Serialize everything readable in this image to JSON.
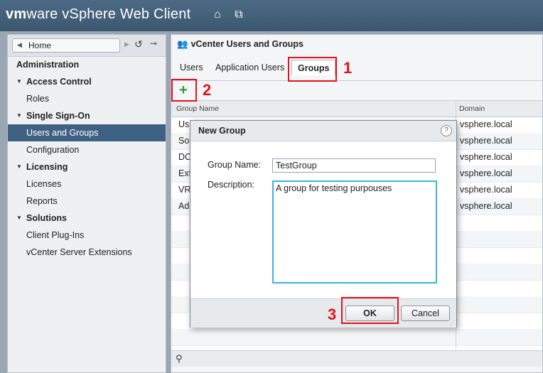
{
  "app": {
    "brand_bold": "vm",
    "brand_rest": "ware",
    "product": " vSphere Web Client"
  },
  "topbar": {
    "home_icon": "home-icon",
    "window_icon": "windows-icon"
  },
  "nav": {
    "home_label": "Home",
    "items": [
      {
        "label": "Administration",
        "kind": "section"
      },
      {
        "label": "Access Control",
        "kind": "group"
      },
      {
        "label": "Roles",
        "kind": "child"
      },
      {
        "label": "Single Sign-On",
        "kind": "group"
      },
      {
        "label": "Users and Groups",
        "kind": "child",
        "selected": true
      },
      {
        "label": "Configuration",
        "kind": "child"
      },
      {
        "label": "Licensing",
        "kind": "group"
      },
      {
        "label": "Licenses",
        "kind": "child"
      },
      {
        "label": "Reports",
        "kind": "child"
      },
      {
        "label": "Solutions",
        "kind": "group"
      },
      {
        "label": "Client Plug-Ins",
        "kind": "child"
      },
      {
        "label": "vCenter Server Extensions",
        "kind": "child"
      }
    ]
  },
  "main": {
    "title": "vCenter Users and Groups",
    "tabs": [
      {
        "label": "Users"
      },
      {
        "label": "Application Users"
      },
      {
        "label": "Groups",
        "active": true
      }
    ],
    "columns": [
      "Group Name",
      "Domain"
    ],
    "rows": [
      [
        "Us",
        "vsphere.local"
      ],
      [
        "So",
        "vsphere.local"
      ],
      [
        "DC",
        "vsphere.local"
      ],
      [
        "Ext",
        "vsphere.local"
      ],
      [
        "VR",
        "vsphere.local"
      ],
      [
        "Adı",
        "vsphere.local"
      ]
    ]
  },
  "dialog": {
    "title": "New Group",
    "help": "?",
    "group_name_label": "Group Name:",
    "group_name_value": "TestGroup",
    "description_label": "Description:",
    "description_value": "A group for testing purpouses",
    "ok_label": "OK",
    "cancel_label": "Cancel"
  },
  "annotations": {
    "one": "1",
    "two": "2",
    "three": "3",
    "color": "#e2141b"
  },
  "colors": {
    "header": "#3c5870",
    "selected_nav": "#3f6184",
    "add_icon": "#2e9a2e",
    "focus": "#38b7d6"
  }
}
